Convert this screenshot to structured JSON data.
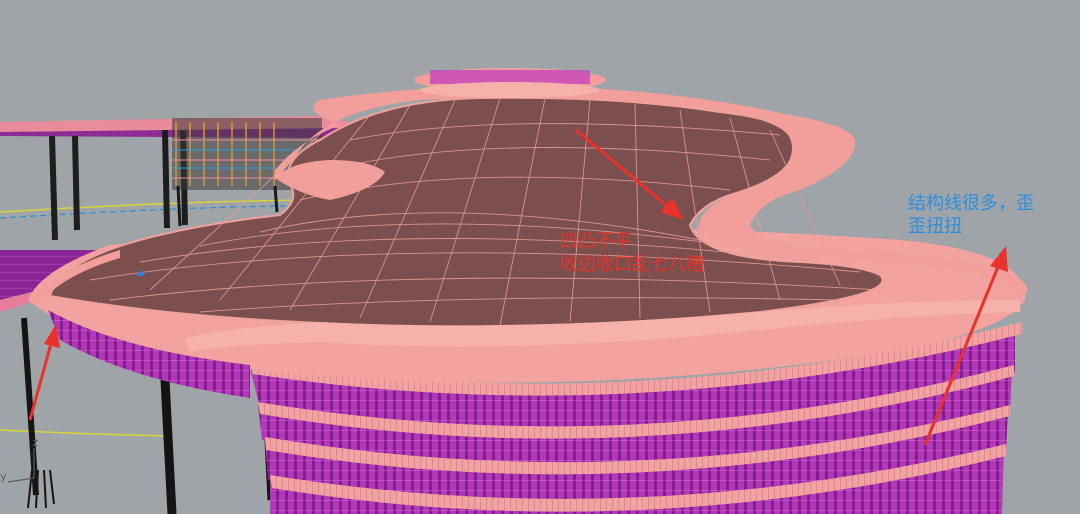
{
  "annotations": {
    "uneven": {
      "line1": "凹凸不平",
      "line2": "收边收口乱七八糟"
    },
    "structure": {
      "line1": "结构线很多，歪",
      "line2": "歪扭扭"
    }
  },
  "axes": {
    "z": "z",
    "y": "y"
  },
  "colors": {
    "background": "#9fa4a8",
    "roof": "#7a4f4e",
    "mesh_line": "#f2a7a0",
    "facade": "#c23ac0",
    "facade_dark": "#7e1f8c",
    "arrow": "#e8322b",
    "annotation_red": "#e8322b",
    "annotation_blue": "#2a8fe0"
  }
}
